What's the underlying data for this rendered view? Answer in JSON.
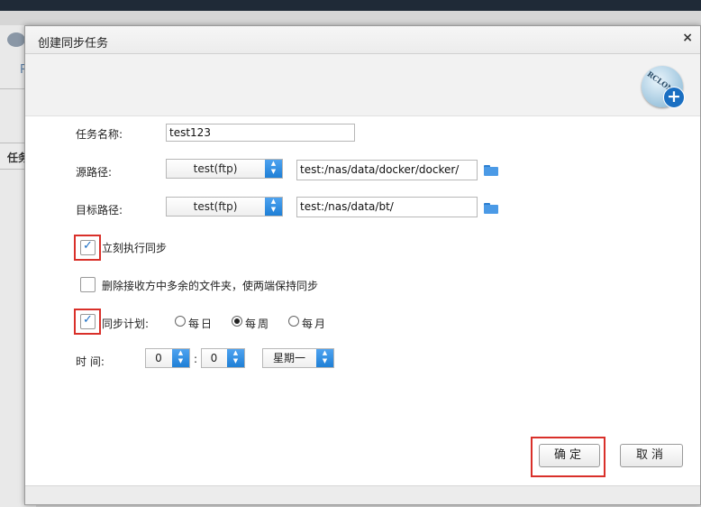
{
  "dialog": {
    "title": "创建同步任务",
    "close": "×",
    "logo_text": "RCLONE",
    "logo_plus": "+"
  },
  "background": {
    "table_header": "任务",
    "tab_letter": "R"
  },
  "form": {
    "task_name_label": "任务名称:",
    "task_name_value": "test123",
    "source_label": "源路径:",
    "source_remote": "test(ftp)",
    "source_path": "test:/nas/data/docker/docker/",
    "target_label": "目标路径:",
    "target_remote": "test(ftp)",
    "target_path": "test:/nas/data/bt/",
    "run_now_label": "立刻执行同步",
    "run_now_checked": true,
    "delete_extra_label": "删除接收方中多余的文件夹，使两端保持同步",
    "delete_extra_checked": false,
    "schedule_label": "同步计划:",
    "schedule_checked": true,
    "schedule_options": [
      "每日",
      "每周",
      "每月"
    ],
    "schedule_selected": "每周",
    "time_label": "时 间:",
    "hour": "0",
    "minute": "0",
    "time_separator": ":",
    "weekday": "星期一"
  },
  "buttons": {
    "ok": "确定",
    "cancel": "取消"
  }
}
